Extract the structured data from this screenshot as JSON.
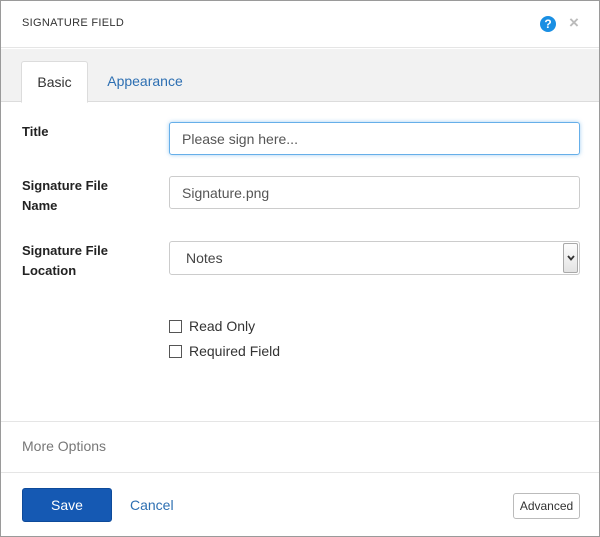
{
  "dialog": {
    "title": "SIGNATURE FIELD",
    "help_icon": "help-circle-icon",
    "help_glyph": "?",
    "close_icon": "close-icon",
    "close_glyph": "×"
  },
  "tabs": [
    {
      "label": "Basic",
      "active": true
    },
    {
      "label": "Appearance",
      "active": false
    }
  ],
  "form": {
    "title_label": "Title",
    "title_placeholder": "Please sign here...",
    "title_value": "",
    "file_name_label_line1": "Signature File",
    "file_name_label_line2": "Name",
    "file_name_value": "Signature.png",
    "location_label_line1": "Signature File",
    "location_label_line2": "Location",
    "location_selected": "Notes",
    "checkboxes": [
      {
        "label": "Read Only",
        "checked": false
      },
      {
        "label": "Required Field",
        "checked": false
      }
    ]
  },
  "more_options_label": "More Options",
  "footer": {
    "save_label": "Save",
    "cancel_label": "Cancel",
    "advanced_label": "Advanced"
  },
  "colors": {
    "accent": "#1559b3",
    "link": "#2d6fb2",
    "help_icon": "#1a8fe3"
  }
}
